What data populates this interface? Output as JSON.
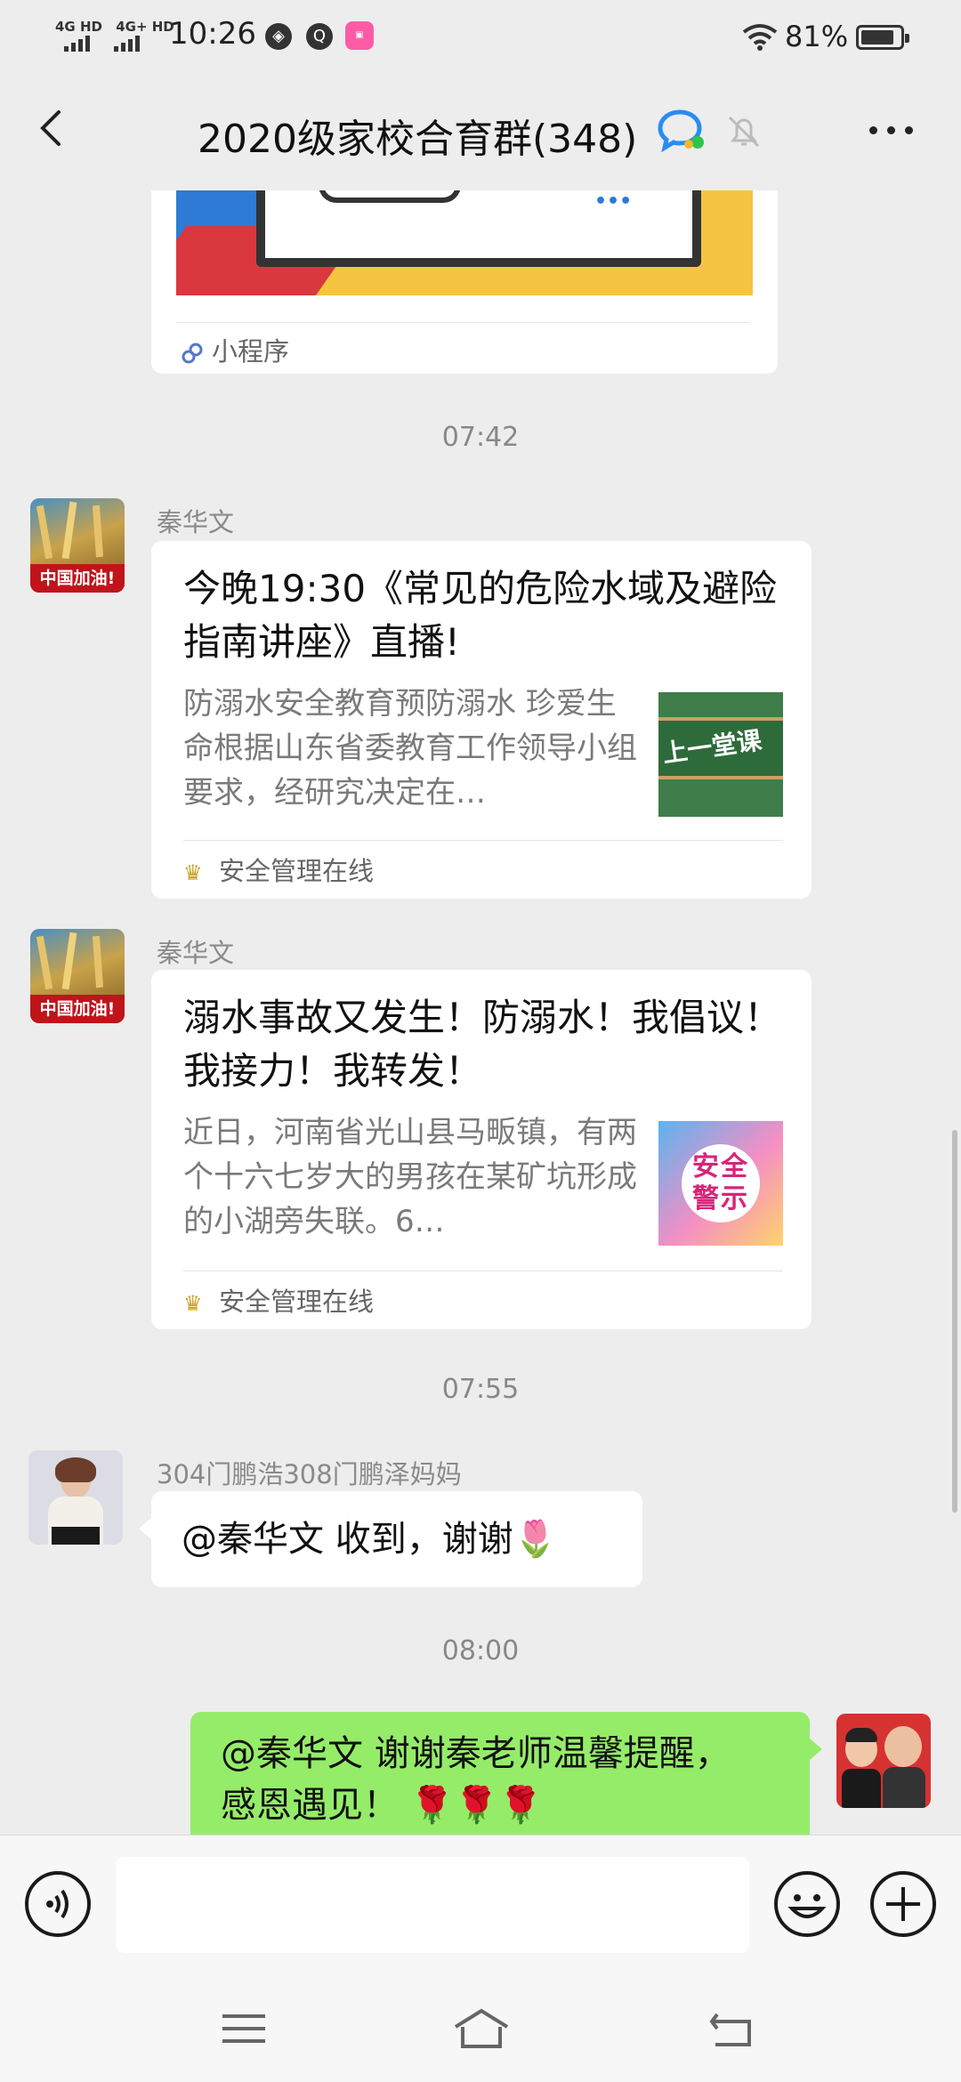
{
  "status_bar": {
    "network_1": "4G HD",
    "network_2": "4G+ HD",
    "time": "10:26",
    "battery": "81%"
  },
  "header": {
    "title": "2020级家校合育群(348)"
  },
  "chat": {
    "top_card": {
      "source": "小程序"
    },
    "messages": [
      {
        "time": "07:42",
        "sender": "秦华文",
        "title": "今晚19:30《常见的危险水域及避险指南讲座》直播!",
        "desc": "防溺水安全教育预防溺水 珍爱生命根据山东省委教育工作领导小组要求，经研究决定在…",
        "thumb_text": "上一堂课",
        "avatar_text": "中国加油!",
        "source": "安全管理在线"
      },
      {
        "sender": "秦华文",
        "title": "溺水事故又发生！防溺水！我倡议！我接力！我转发！",
        "desc": "近日，河南省光山县马畈镇，有两个十六七岁大的男孩在某矿坑形成的小湖旁失联。6…",
        "thumb_text": "安全警示",
        "avatar_text": "中国加油!",
        "source": "安全管理在线"
      },
      {
        "time": "07:55",
        "sender": "304门鹏浩308门鹏泽妈妈",
        "text": "@秦华文  收到，谢谢"
      },
      {
        "time": "08:00",
        "text_line1": "@秦华文  谢谢秦老师温馨提醒，",
        "text_line2": "感恩遇见！"
      }
    ]
  },
  "input": {
    "value": "",
    "placeholder": ""
  },
  "icons": {
    "tulip": "🌷",
    "rose": "🌹"
  }
}
